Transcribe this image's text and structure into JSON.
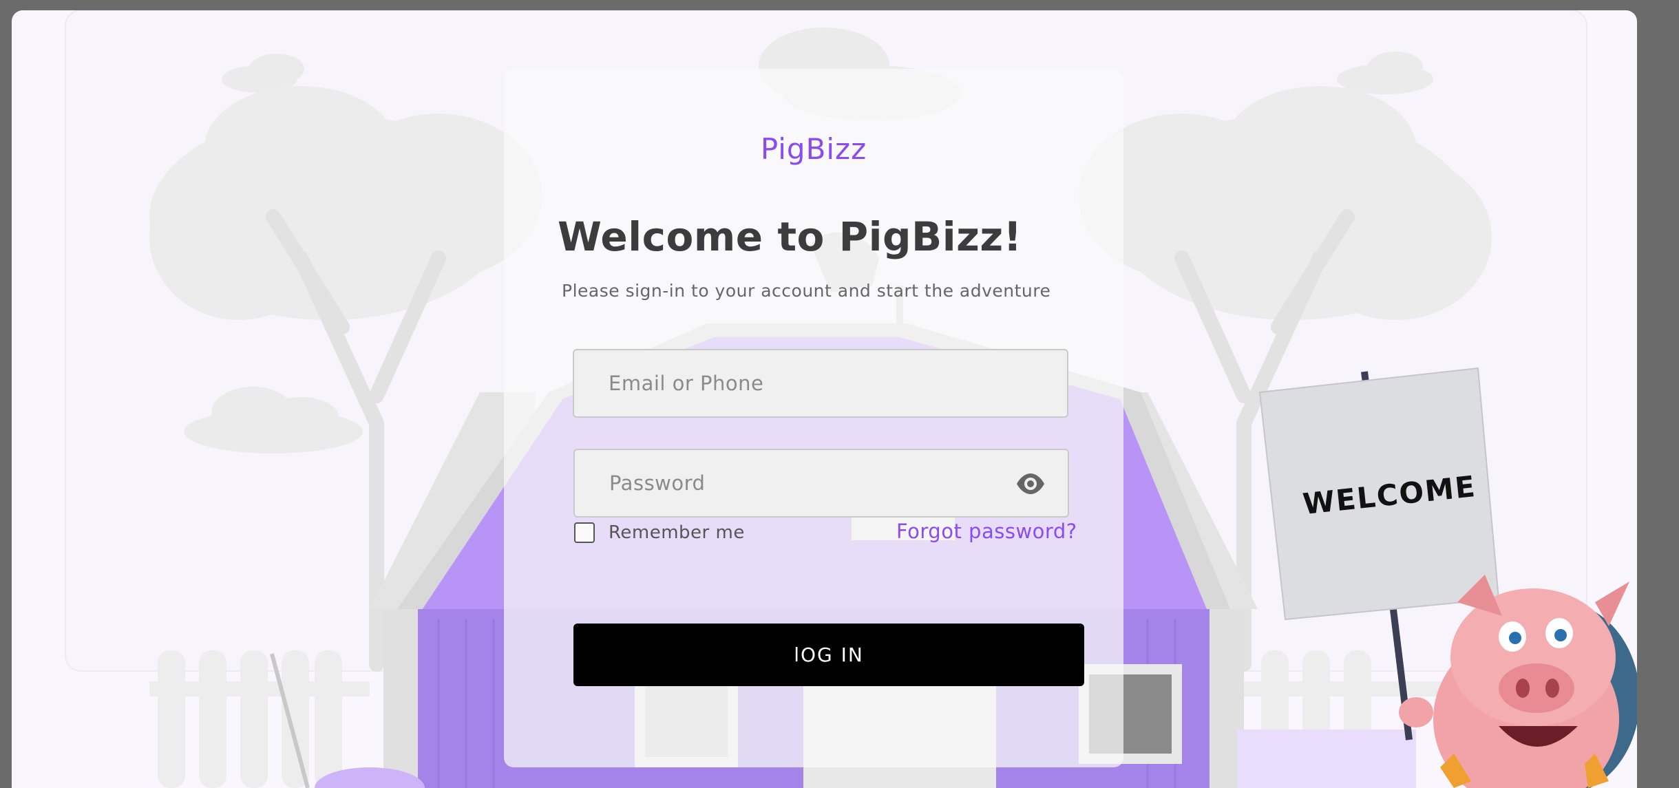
{
  "brand": "PigBizz",
  "welcome_title": "Welcome to PigBizz!",
  "subtitle": "Please sign-in to your account and start the adventure",
  "email": {
    "placeholder": "Email or Phone",
    "value": ""
  },
  "password": {
    "placeholder": "Password",
    "value": ""
  },
  "remember_label": "Remember me",
  "remember_checked": false,
  "forgot_label": "Forgot password?",
  "login_label": "lOG IN",
  "sign_text": "WELCOME",
  "icons": {
    "password_toggle": "eye-icon",
    "mascot": "pig-mascot"
  },
  "colors": {
    "accent": "#8a4cf2",
    "login_bg": "#000000",
    "barn": "#b794f6"
  }
}
